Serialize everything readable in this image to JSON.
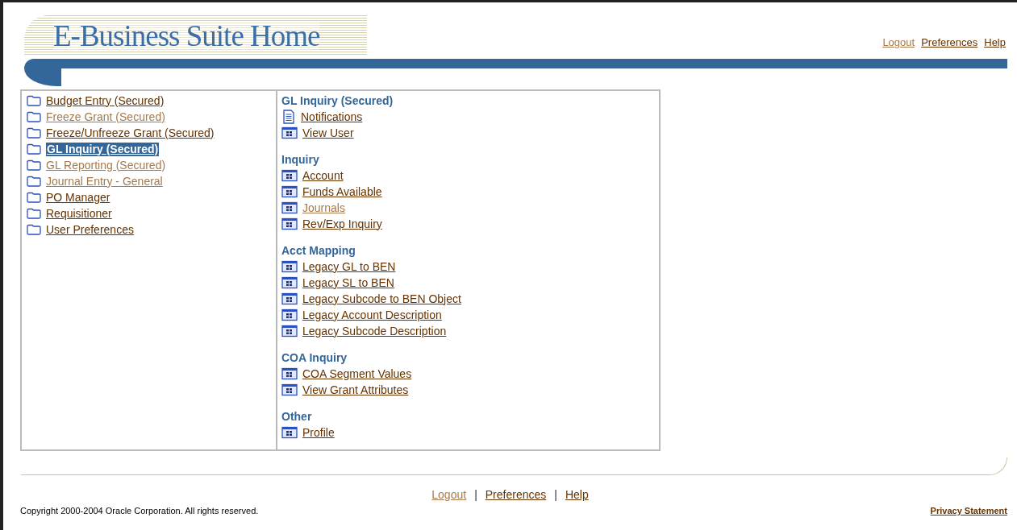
{
  "header": {
    "title": "E-Business Suite Home",
    "links": [
      {
        "label": "Logout",
        "visited": true
      },
      {
        "label": "Preferences",
        "visited": false
      },
      {
        "label": "Help",
        "visited": false
      }
    ]
  },
  "responsibilities": [
    {
      "label": "Budget Entry (Secured)",
      "visited": false,
      "selected": false
    },
    {
      "label": "Freeze Grant (Secured)",
      "visited": true,
      "selected": false
    },
    {
      "label": "Freeze/Unfreeze Grant (Secured)",
      "visited": false,
      "selected": false
    },
    {
      "label": "GL Inquiry (Secured)",
      "selected": true
    },
    {
      "label": "GL Reporting (Secured)",
      "visited": true,
      "selected": false
    },
    {
      "label": "Journal Entry - General",
      "visited": true,
      "selected": false
    },
    {
      "label": "PO Manager",
      "visited": false,
      "selected": false
    },
    {
      "label": "Requisitioner",
      "visited": false,
      "selected": false
    },
    {
      "label": "User Preferences",
      "visited": false,
      "selected": false
    }
  ],
  "sections": [
    {
      "heading": "GL Inquiry (Secured)",
      "items": [
        {
          "label": "Notifications",
          "kind": "document",
          "visited": false
        },
        {
          "label": "View User",
          "kind": "form",
          "visited": false
        }
      ]
    },
    {
      "heading": "Inquiry",
      "items": [
        {
          "label": "Account",
          "kind": "form",
          "visited": false
        },
        {
          "label": "Funds Available",
          "kind": "form",
          "visited": false
        },
        {
          "label": "Journals",
          "kind": "form",
          "visited": true
        },
        {
          "label": "Rev/Exp Inquiry",
          "kind": "form",
          "visited": false
        }
      ]
    },
    {
      "heading": "Acct Mapping",
      "items": [
        {
          "label": "Legacy GL to BEN",
          "kind": "form",
          "visited": false
        },
        {
          "label": "Legacy SL to BEN",
          "kind": "form",
          "visited": false
        },
        {
          "label": "Legacy Subcode to BEN Object",
          "kind": "form",
          "visited": false
        },
        {
          "label": "Legacy Account Description",
          "kind": "form",
          "visited": false
        },
        {
          "label": "Legacy Subcode Description",
          "kind": "form",
          "visited": false
        }
      ]
    },
    {
      "heading": "COA Inquiry",
      "items": [
        {
          "label": "COA Segment Values",
          "kind": "form",
          "visited": false
        },
        {
          "label": "View Grant Attributes",
          "kind": "form",
          "visited": false
        }
      ]
    },
    {
      "heading": "Other",
      "items": [
        {
          "label": "Profile",
          "kind": "form",
          "visited": false
        }
      ]
    }
  ],
  "footer": {
    "links": [
      {
        "label": "Logout",
        "visited": true
      },
      {
        "label": "Preferences",
        "visited": false
      },
      {
        "label": "Help",
        "visited": false
      }
    ],
    "separator": "|",
    "copyright": "Copyright 2000-2004 Oracle Corporation. All rights reserved.",
    "privacy": "Privacy Statement"
  }
}
